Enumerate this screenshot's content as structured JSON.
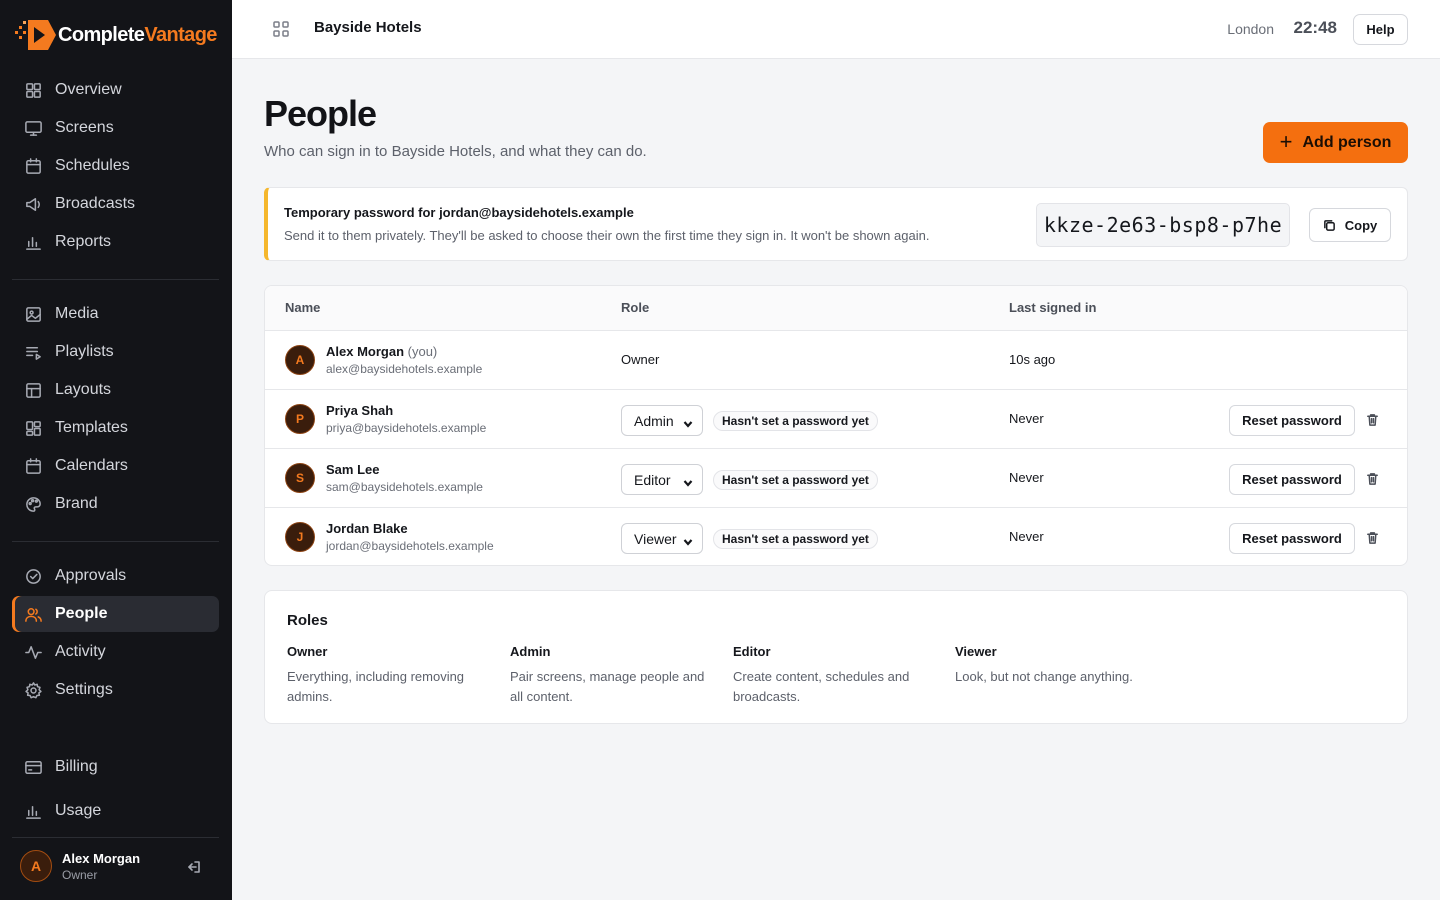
{
  "brand": {
    "name_part1": "Complete",
    "name_part2": "Vantage",
    "accent": "#f47a1f"
  },
  "sidebar": {
    "groups": [
      [
        {
          "label": "Overview",
          "icon": "grid-icon"
        },
        {
          "label": "Screens",
          "icon": "monitor-icon"
        },
        {
          "label": "Schedules",
          "icon": "calendar-icon"
        },
        {
          "label": "Broadcasts",
          "icon": "megaphone-icon"
        },
        {
          "label": "Reports",
          "icon": "bar-chart-icon"
        }
      ],
      [
        {
          "label": "Media",
          "icon": "image-icon"
        },
        {
          "label": "Playlists",
          "icon": "playlist-icon"
        },
        {
          "label": "Layouts",
          "icon": "layout-icon"
        },
        {
          "label": "Templates",
          "icon": "templates-icon"
        },
        {
          "label": "Calendars",
          "icon": "calendar-icon"
        },
        {
          "label": "Brand",
          "icon": "palette-icon"
        }
      ],
      [
        {
          "label": "Approvals",
          "icon": "check-circle-icon"
        },
        {
          "label": "People",
          "icon": "users-icon",
          "active": true
        },
        {
          "label": "Activity",
          "icon": "activity-icon"
        },
        {
          "label": "Settings",
          "icon": "gear-icon"
        }
      ],
      [
        {
          "label": "Billing",
          "icon": "credit-card-icon"
        },
        {
          "label": "Usage",
          "icon": "bar-chart-icon"
        }
      ]
    ],
    "user": {
      "initial": "A",
      "name": "Alex Morgan",
      "role": "Owner"
    }
  },
  "topbar": {
    "workspace": "Bayside Hotels",
    "city": "London",
    "time": "22:48",
    "help_label": "Help"
  },
  "page": {
    "title": "People",
    "subtitle": "Who can sign in to Bayside Hotels, and what they can do.",
    "add_label": "Add person"
  },
  "notice": {
    "title": "Temporary password for jordan@baysidehotels.example",
    "text": "Send it to them privately. They'll be asked to choose their own the first time they sign in. It won't be shown again.",
    "password": "kkze-2e63-bsp8-p7he",
    "copy_label": "Copy"
  },
  "table": {
    "headers": {
      "name": "Name",
      "role": "Role",
      "last": "Last signed in"
    },
    "rows": [
      {
        "initial": "A",
        "name": "Alex Morgan",
        "you": "(you)",
        "email": "alex@baysidehotels.example",
        "role": "Owner",
        "editable": false,
        "badge": "",
        "last": "10s ago"
      },
      {
        "initial": "P",
        "name": "Priya Shah",
        "you": "",
        "email": "priya@baysidehotels.example",
        "role": "Admin",
        "editable": true,
        "badge": "Hasn't set a password yet",
        "last": "Never",
        "reset": "Reset password"
      },
      {
        "initial": "S",
        "name": "Sam Lee",
        "you": "",
        "email": "sam@baysidehotels.example",
        "role": "Editor",
        "editable": true,
        "badge": "Hasn't set a password yet",
        "last": "Never",
        "reset": "Reset password"
      },
      {
        "initial": "J",
        "name": "Jordan Blake",
        "you": "",
        "email": "jordan@baysidehotels.example",
        "role": "Viewer",
        "editable": true,
        "badge": "Hasn't set a password yet",
        "last": "Never",
        "reset": "Reset password"
      }
    ]
  },
  "roles": {
    "title": "Roles",
    "items": [
      {
        "name": "Owner",
        "desc": "Everything, including removing admins."
      },
      {
        "name": "Admin",
        "desc": "Pair screens, manage people and all content."
      },
      {
        "name": "Editor",
        "desc": "Create content, schedules and broadcasts."
      },
      {
        "name": "Viewer",
        "desc": "Look, but not change anything."
      }
    ]
  }
}
